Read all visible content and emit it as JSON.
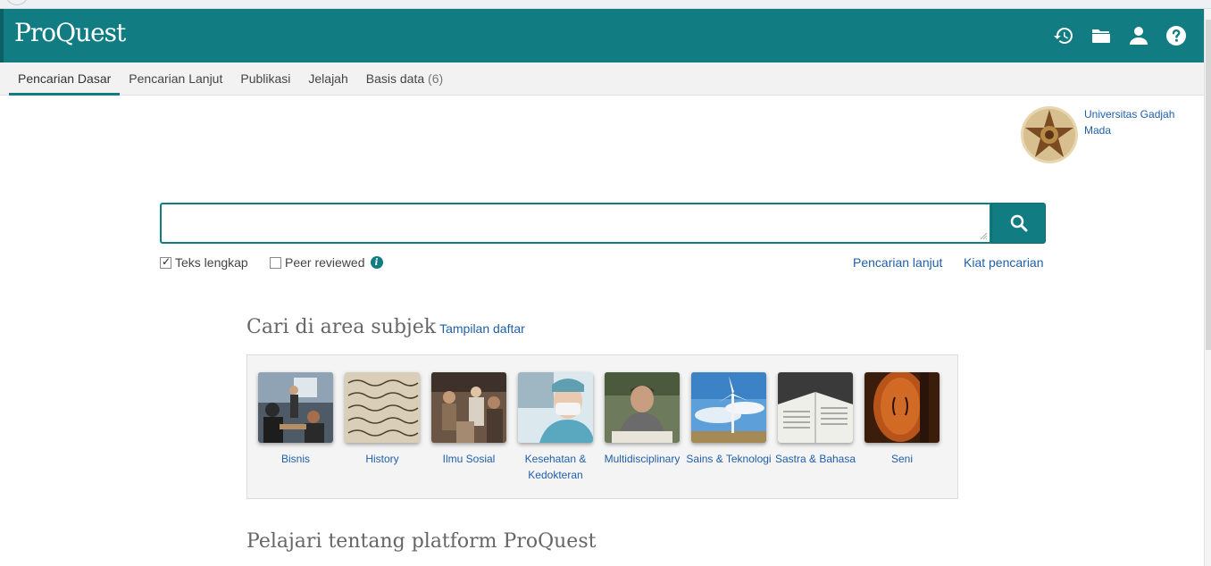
{
  "header": {
    "logo": "ProQuest"
  },
  "nav": [
    {
      "label": "Pencarian Dasar"
    },
    {
      "label": "Pencarian Lanjut"
    },
    {
      "label": "Publikasi"
    },
    {
      "label": "Jelajah"
    },
    {
      "label": "Basis data",
      "count": "(6)"
    }
  ],
  "institution": {
    "name": "Universitas Gadjah Mada"
  },
  "search": {
    "value": "",
    "full_text_label": "Teks lengkap",
    "peer_reviewed_label": "Peer reviewed",
    "advanced_link": "Pencarian lanjut",
    "tips_link": "Kiat pencarian"
  },
  "subjects_section": {
    "title": "Cari di area subjek",
    "list_view_link": "Tampilan daftar",
    "items": [
      {
        "label": "Bisnis"
      },
      {
        "label": "History"
      },
      {
        "label": "Ilmu Sosial"
      },
      {
        "label": "Kesehatan & Kedokteran"
      },
      {
        "label": "Multidisciplinary"
      },
      {
        "label": "Sains & Teknologi"
      },
      {
        "label": "Sastra & Bahasa"
      },
      {
        "label": "Seni"
      }
    ]
  },
  "learn_section": {
    "title": "Pelajari tentang platform ProQuest"
  },
  "colors": {
    "brand": "#127c83",
    "link": "#1f5fa8"
  }
}
